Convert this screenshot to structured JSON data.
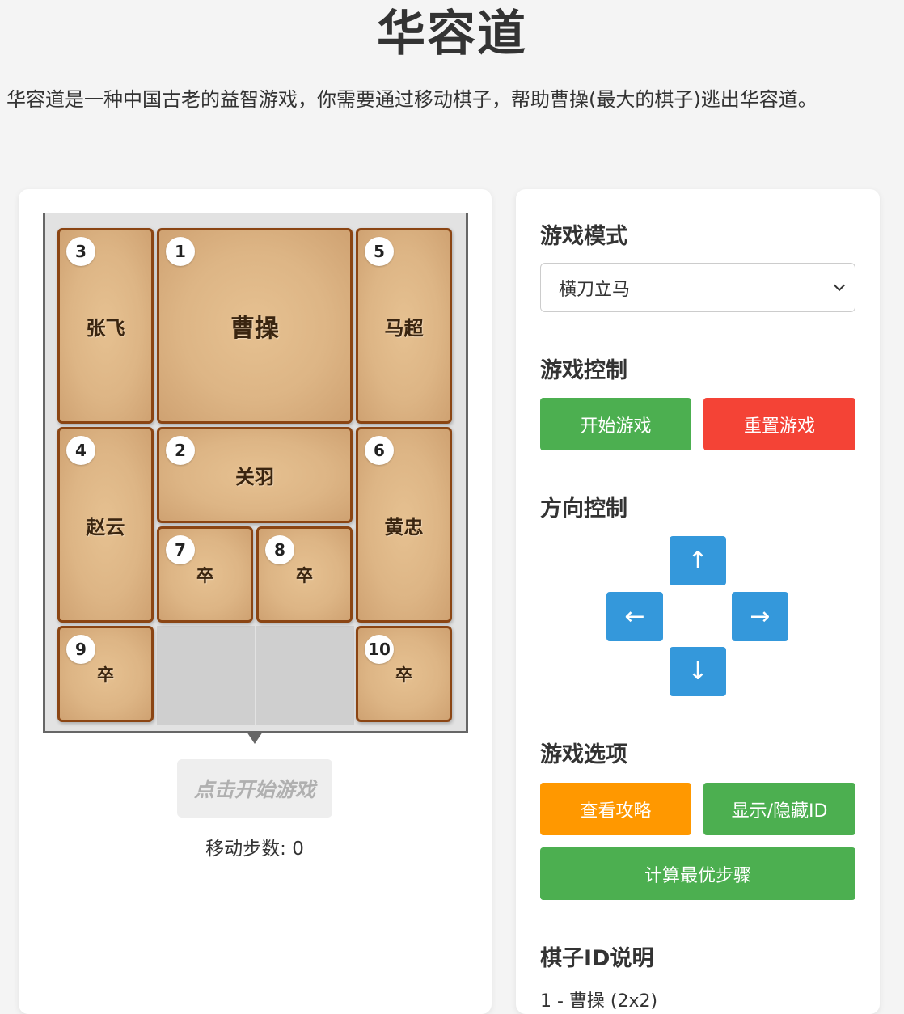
{
  "page": {
    "title": "华容道",
    "description": "华容道是一种中国古老的益智游戏，你需要通过移动棋子，帮助曹操(最大的棋子)逃出华容道。"
  },
  "board": {
    "rows": 5,
    "cols": 4,
    "pieces": [
      {
        "id": "3",
        "name": "张飞",
        "col": 0,
        "row": 0,
        "w": 1,
        "h": 2
      },
      {
        "id": "1",
        "name": "曹操",
        "col": 1,
        "row": 0,
        "w": 2,
        "h": 2
      },
      {
        "id": "5",
        "name": "马超",
        "col": 3,
        "row": 0,
        "w": 1,
        "h": 2
      },
      {
        "id": "4",
        "name": "赵云",
        "col": 0,
        "row": 2,
        "w": 1,
        "h": 2
      },
      {
        "id": "2",
        "name": "关羽",
        "col": 1,
        "row": 2,
        "w": 2,
        "h": 1
      },
      {
        "id": "6",
        "name": "黄忠",
        "col": 3,
        "row": 2,
        "w": 1,
        "h": 2
      },
      {
        "id": "7",
        "name": "卒",
        "col": 1,
        "row": 3,
        "w": 1,
        "h": 1
      },
      {
        "id": "8",
        "name": "卒",
        "col": 2,
        "row": 3,
        "w": 1,
        "h": 1
      },
      {
        "id": "9",
        "name": "卒",
        "col": 0,
        "row": 4,
        "w": 1,
        "h": 1
      },
      {
        "id": "10",
        "name": "卒",
        "col": 3,
        "row": 4,
        "w": 1,
        "h": 1
      }
    ],
    "empty_cells": [
      {
        "col": 1,
        "row": 4
      },
      {
        "col": 2,
        "row": 4
      }
    ]
  },
  "game": {
    "start_hint": "点击开始游戏",
    "steps_label": "移动步数: 0"
  },
  "panel": {
    "mode_title": "游戏模式",
    "mode_selected": "横刀立马",
    "control_title": "游戏控制",
    "start_button": "开始游戏",
    "reset_button": "重置游戏",
    "direction_title": "方向控制",
    "up": "↑",
    "left": "←",
    "right": "→",
    "down": "↓",
    "options_title": "游戏选项",
    "guide_button": "查看攻略",
    "toggle_id_button": "显示/隐藏ID",
    "solve_button": "计算最优步骤",
    "id_title": "棋子ID说明",
    "id_note_first": "1 - 曹操 (2x2)"
  },
  "colors": {
    "green": "#4caf50",
    "red": "#f44336",
    "orange": "#ff9800",
    "blue": "#3498db",
    "piece_border": "#8b4513"
  }
}
